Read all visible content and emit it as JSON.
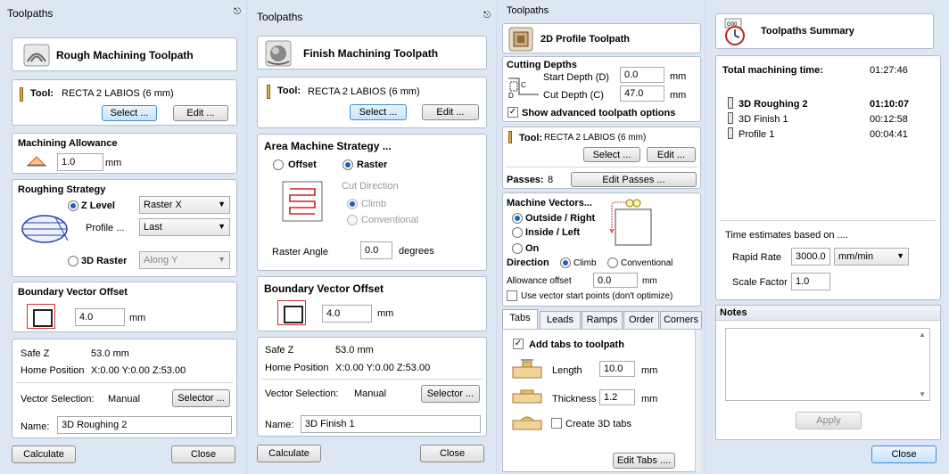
{
  "rough": {
    "header": "Toolpaths",
    "title": "Rough Machining Toolpath",
    "tool_label": "Tool:",
    "tool_name": "RECTA 2 LABIOS (6 mm)",
    "select_btn": "Select ...",
    "edit_btn": "Edit ...",
    "allowance_title": "Machining Allowance",
    "allowance_value": "1.0",
    "allowance_unit": "mm",
    "strategy_title": "Roughing Strategy",
    "zlevel_label": "Z Level",
    "zlevel_mode": "Raster X",
    "profile_label": "Profile ...",
    "profile_mode": "Last",
    "raster3d_label": "3D Raster",
    "raster3d_mode": "Along Y",
    "boundary_title": "Boundary Vector Offset",
    "boundary_value": "4.0",
    "boundary_unit": "mm",
    "safez_label": "Safe Z",
    "safez_value": "53.0 mm",
    "home_label": "Home Position",
    "home_value": "X:0.00 Y:0.00 Z:53.00",
    "vecsel_label": "Vector Selection:",
    "vecsel_value": "Manual",
    "selector_btn": "Selector ...",
    "name_label": "Name:",
    "name_value": "3D Roughing 2",
    "calculate_btn": "Calculate",
    "close_btn": "Close"
  },
  "finish": {
    "header": "Toolpaths",
    "title": "Finish Machining Toolpath",
    "tool_label": "Tool:",
    "tool_name": "RECTA 2 LABIOS (6 mm)",
    "select_btn": "Select ...",
    "edit_btn": "Edit ...",
    "area_title": "Area Machine Strategy ...",
    "offset_label": "Offset",
    "raster_label": "Raster",
    "cut_dir_label": "Cut Direction",
    "climb_label": "Climb",
    "conventional_label": "Conventional",
    "raster_angle_label": "Raster Angle",
    "raster_angle_value": "0.0",
    "raster_angle_unit": "degrees",
    "boundary_title": "Boundary Vector Offset",
    "boundary_value": "4.0",
    "boundary_unit": "mm",
    "safez_label": "Safe Z",
    "safez_value": "53.0 mm",
    "home_label": "Home Position",
    "home_value": "X:0.00 Y:0.00 Z:53.00",
    "vecsel_label": "Vector Selection:",
    "vecsel_value": "Manual",
    "selector_btn": "Selector ...",
    "name_label": "Name:",
    "name_value": "3D Finish 1",
    "calculate_btn": "Calculate",
    "close_btn": "Close"
  },
  "profile": {
    "header": "Toolpaths",
    "title": "2D Profile Toolpath",
    "cutting_depths_title": "Cutting Depths",
    "start_depth_label": "Start Depth (D)",
    "start_depth_value": "0.0",
    "cut_depth_label": "Cut Depth (C)",
    "cut_depth_value": "47.0",
    "depth_unit": "mm",
    "show_advanced_label": "Show advanced toolpath options",
    "tool_label": "Tool:",
    "tool_name": "RECTA 2 LABIOS (6 mm)",
    "select_btn": "Select ...",
    "edit_btn": "Edit ...",
    "passes_label": "Passes:",
    "passes_value": "8",
    "edit_passes_btn": "Edit Passes ...",
    "machine_vectors_title": "Machine Vectors...",
    "outside_label": "Outside / Right",
    "inside_label": "Inside / Left",
    "on_label": "On",
    "direction_label": "Direction",
    "climb_label": "Climb",
    "conventional_label": "Conventional",
    "allowance_label": "Allowance offset",
    "allowance_value": "0.0",
    "allowance_unit": "mm",
    "vector_start_label": "Use vector start points (don't optimize)",
    "tabs": [
      "Tabs",
      "Leads",
      "Ramps",
      "Order",
      "Corners"
    ],
    "add_tabs_label": "Add tabs to toolpath",
    "length_label": "Length",
    "length_value": "10.0",
    "thickness_label": "Thickness",
    "thickness_value": "1.2",
    "tab_unit": "mm",
    "create_3d_label": "Create 3D tabs",
    "edit_tabs_btn": "Edit Tabs ...."
  },
  "summary": {
    "title": "Toolpaths Summary",
    "total_label": "Total machining time:",
    "total_value": "01:27:46",
    "items": [
      {
        "name": "3D Roughing 2",
        "time": "01:10:07"
      },
      {
        "name": "3D Finish 1",
        "time": "00:12:58"
      },
      {
        "name": "Profile 1",
        "time": "00:04:41"
      }
    ],
    "estimates_label": "Time estimates based on ....",
    "rapid_label": "Rapid Rate",
    "rapid_value": "3000.0",
    "rapid_unit": "mm/min",
    "scale_label": "Scale Factor",
    "scale_value": "1.0",
    "notes_title": "Notes",
    "apply_btn": "Apply",
    "close_btn": "Close"
  }
}
